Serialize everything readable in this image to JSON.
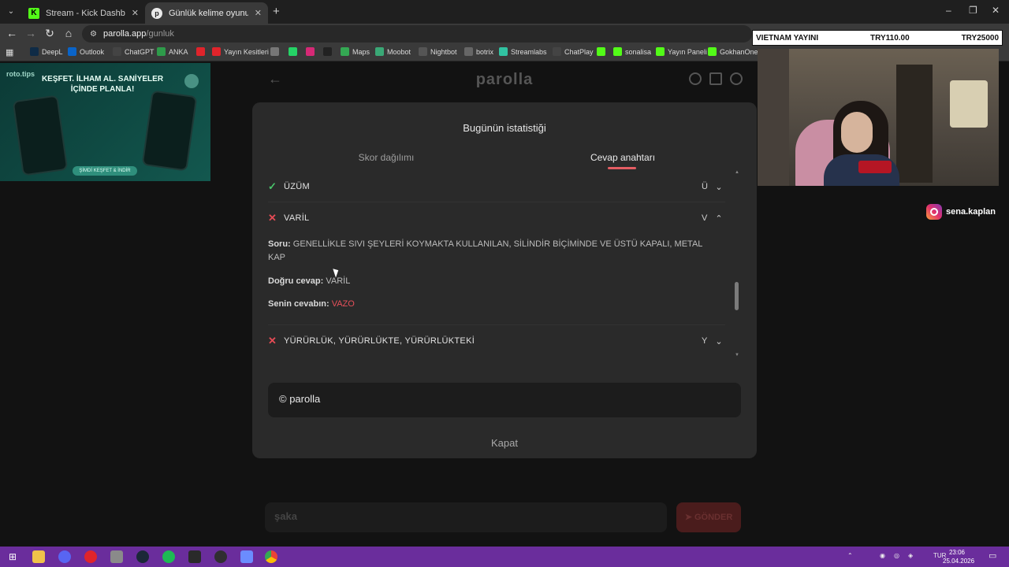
{
  "browser": {
    "tabs": [
      {
        "title": "Stream - Kick Dashboard",
        "active": false
      },
      {
        "title": "Günlük kelime oyunu - parolla",
        "active": true
      }
    ],
    "new_tab": "+",
    "window_controls": {
      "minimize": "–",
      "maximize": "❐",
      "close": "✕"
    },
    "url_host": "parolla.app",
    "url_path": "/gunluk",
    "bookmarks": [
      {
        "label": "DeepL",
        "color": "#0f2b46"
      },
      {
        "label": "Outlook",
        "color": "#0a64c8"
      },
      {
        "label": "ChatGPT",
        "color": "#444444"
      },
      {
        "label": "ANKA",
        "color": "#2e9b4a"
      },
      {
        "label": "",
        "color": "#e0242b"
      },
      {
        "label": "Yayın Kesitleri",
        "color": "#e0242b"
      },
      {
        "label": "",
        "color": "#777777"
      },
      {
        "label": "",
        "color": "#25d366"
      },
      {
        "label": "",
        "color": "#d62976"
      },
      {
        "label": "",
        "color": "#222222"
      },
      {
        "label": "Maps",
        "color": "#34a853"
      },
      {
        "label": "Moobot",
        "color": "#3aa876"
      },
      {
        "label": "Nightbot",
        "color": "#555555"
      },
      {
        "label": "botrix",
        "color": "#666666"
      },
      {
        "label": "Streamlabs",
        "color": "#31c3a2"
      },
      {
        "label": "ChatPlay",
        "color": "#444444"
      },
      {
        "label": "",
        "color": "#53fc18"
      },
      {
        "label": "sonalisa",
        "color": "#53fc18"
      },
      {
        "label": "Yayın Paneli",
        "color": "#53fc18"
      },
      {
        "label": "GokhanOner S",
        "color": "#53fc18"
      }
    ]
  },
  "overlay": {
    "ad_brand": "roto.tips",
    "ad_title": "KEŞFET. İLHAM AL. SANİYELER İÇİNDE PLANLA!",
    "ad_cta": "ŞİMDİ KEŞFET & İNDİR",
    "donation": {
      "label": "VIETNAM YAYINI",
      "current": "TRY110.00",
      "goal": "TRY25000"
    },
    "instagram": "sena.kaplan"
  },
  "app": {
    "logo": "parolla",
    "guess_placeholder": "şaka",
    "send_label": "➤ GÖNDER"
  },
  "modal": {
    "title": "Bugünün istatistiği",
    "tabs": [
      "Skor dağılımı",
      "Cevap anahtarı"
    ],
    "active_tab": 1,
    "rows": [
      {
        "word": "ÜZÜM",
        "letter": "Ü",
        "correct": true,
        "expanded": false
      },
      {
        "word": "VARİL",
        "letter": "V",
        "correct": false,
        "expanded": true
      },
      {
        "word": "YÜRÜRLÜK, YÜRÜRLÜKTE, YÜRÜRLÜKTEKİ",
        "letter": "Y",
        "correct": false,
        "expanded": false
      }
    ],
    "detail": {
      "question_label": "Soru:",
      "question": "GENELLİKLE SIVI ŞEYLERİ KOYMAKTA KULLANILAN, SİLİNDİR BİÇİMİNDE VE ÜSTÜ KAPALI, METAL KAP",
      "correct_label": "Doğru cevap:",
      "correct_answer": "VARİL",
      "your_label": "Senin cevabın:",
      "your_answer": "VAZO"
    },
    "footer": "© parolla",
    "close_label": "Kapat"
  },
  "taskbar": {
    "time": "23:06",
    "date": "25.04.2026",
    "lang": "TUR"
  },
  "colors": {
    "accent": "#e45d63",
    "correct": "#49c46a",
    "wrong": "#e54b55",
    "taskbar": "#6a2d9c"
  }
}
